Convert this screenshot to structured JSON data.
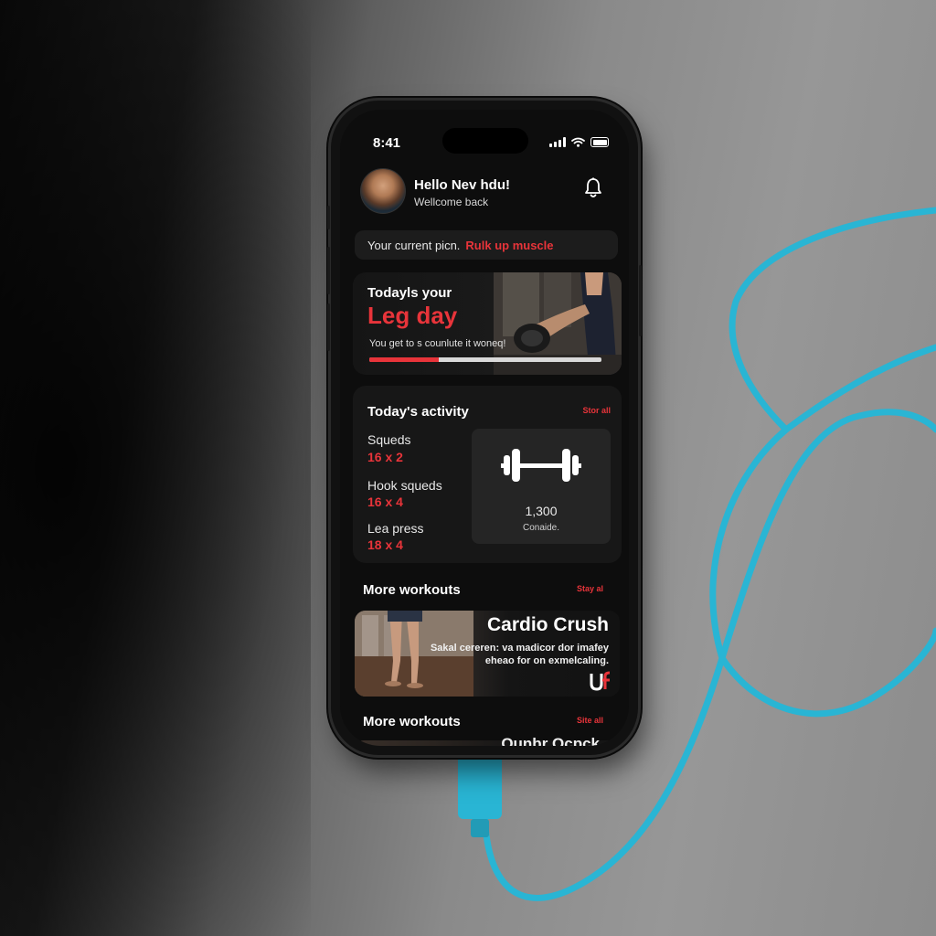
{
  "status_bar": {
    "time": "8:41"
  },
  "header": {
    "greeting": "Hello Nev hdu!",
    "subtitle": "Wellcome back"
  },
  "plan": {
    "label": "Your current picn.",
    "value": "Rulk up muscle"
  },
  "hero": {
    "title": "Todayls your",
    "highlight": "Leg day",
    "description": "You get to s counlute it woneq!",
    "progress": 0.3
  },
  "activity": {
    "title": "Today's activity",
    "link": "Stor all",
    "exercises": [
      {
        "name": "Squeds",
        "sets": "16 x 2"
      },
      {
        "name": "Hook squeds",
        "sets": "16 x 4"
      },
      {
        "name": "Lea press",
        "sets": "18 x 4"
      }
    ],
    "stat": {
      "value": "1,300",
      "label": "Conaide."
    }
  },
  "more_workouts_1": {
    "title": "More workouts",
    "link": "Stay al",
    "card": {
      "title": "Cardio Crush",
      "description": "Sakal cereren: va madicor dor imafey eheao for on exmelcaling."
    }
  },
  "more_workouts_2": {
    "title": "More workouts",
    "link": "Site all",
    "peek_title": "Ounbr Ocpck"
  },
  "colors": {
    "accent": "#e8343a",
    "cable": "#29b5d4",
    "screen_bg": "#0d0d0d"
  },
  "icons": [
    "avatar",
    "bell-icon",
    "dumbbell-icon",
    "signal-icon",
    "wifi-icon",
    "battery-icon",
    "brand-logo-icon"
  ]
}
